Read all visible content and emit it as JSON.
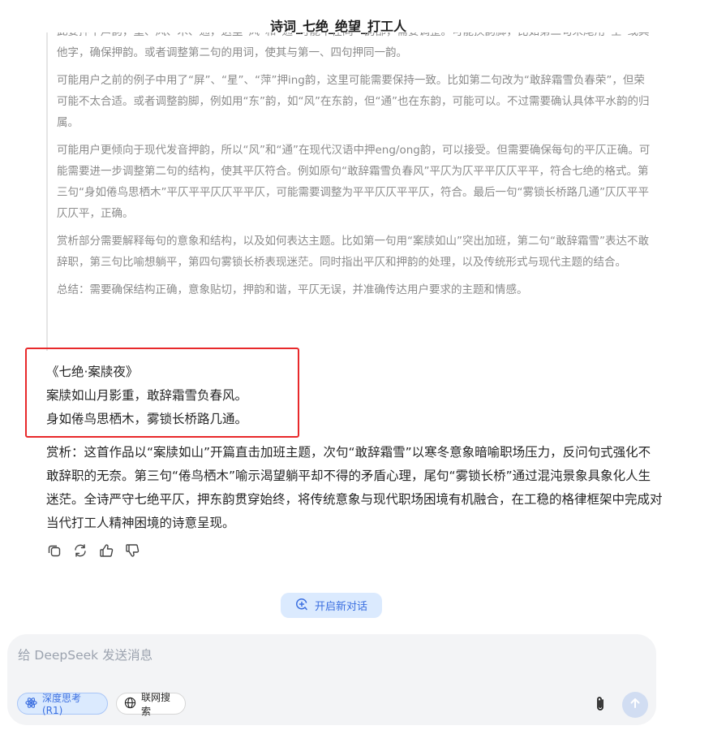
{
  "header": {
    "title": "诗词_七绝_绝望_打工人"
  },
  "thinking": {
    "paragraphs": [
      "此要押平声韵，重、风、木、通，这里“风”和“通”可能不在同一韵部，需要调整。可能换韵脚，比如第二句末尾用“空”或其他字，确保押韵。或者调整第二句的用词，使其与第一、四句押同一韵。",
      "可能用户之前的例子中用了“屏”、“星”、“萍”押ing韵，这里可能需要保持一致。比如第二句改为“敢辞霜雪负春荣”，但荣可能不太合适。或者调整韵脚，例如用“东”韵，如“风”在东韵，但“通”也在东韵，可能可以。不过需要确认具体平水韵的归属。",
      "可能用户更倾向于现代发音押韵，所以“风”和“通”在现代汉语中押eng/ong韵，可以接受。但需要确保每句的平仄正确。可能需要进一步调整第二句的结构，使其平仄符合。例如原句“敢辞霜雪负春风”平仄为仄平平仄仄平平，符合七绝的格式。第三句“身如倦鸟思栖木”平仄平平仄仄平平仄，可能需要调整为平平仄仄平平仄，符合。最后一句“雾锁长桥路几通”仄仄平平仄仄平，正确。",
      "赏析部分需要解释每句的意象和结构，以及如何表达主题。比如第一句用“案牍如山”突出加班，第二句“敢辞霜雪”表达不敢辞职，第三句比喻想躺平，第四句雾锁长桥表现迷茫。同时指出平仄和押韵的处理，以及传统形式与现代主题的结合。",
      "总结：需要确保结构正确，意象贴切，押韵和谐，平仄无误，并准确传达用户要求的主题和情感。"
    ]
  },
  "answer": {
    "poem_title": "《七绝·案牍夜》",
    "poem_lines": [
      "案牍如山月影重，敢辞霜雪负春风。",
      "身如倦鸟思栖木，雾锁长桥路几通。"
    ],
    "appreciation": "赏析：这首作品以“案牍如山”开篇直击加班主题，次句“敢辞霜雪”以寒冬意象暗喻职场压力，反问句式强化不敢辞职的无奈。第三句“倦鸟栖木”喻示渴望躺平却不得的矛盾心理，尾句“雾锁长桥”通过混沌景象具象化人生迷茫。全诗严守七绝平仄，押东韵贯穿始终，将传统意象与现代职场困境有机融合，在工稳的格律框架中完成对当代打工人精神困境的诗意呈现。"
  },
  "actions": {
    "icons": [
      "copy-icon",
      "regenerate-icon",
      "thumbs-up-icon",
      "thumbs-down-icon"
    ]
  },
  "new_chat": {
    "label": "开启新对话"
  },
  "composer": {
    "placeholder": "给 DeepSeek 发送消息",
    "deep_think_label": "深度思考 (R1)",
    "web_search_label": "联网搜索"
  },
  "colors": {
    "accent": "#3b6fe0",
    "highlight_box": "#e8292b",
    "composer_bg": "#f3f4f6"
  }
}
